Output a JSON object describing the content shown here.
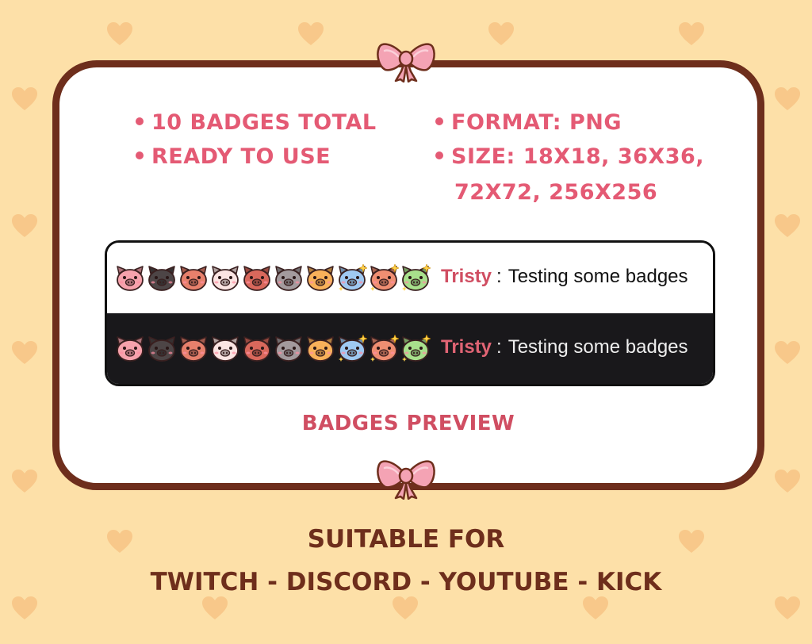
{
  "features": {
    "left": [
      "10 BADGES TOTAL",
      "READY TO USE"
    ],
    "right_line1": "FORMAT: PNG",
    "right_line2": "SIZE: 18X18, 36X36,",
    "right_line3": "72X72, 256X256"
  },
  "preview": {
    "username": "Tristy",
    "separator": ":",
    "message": "Testing some badges",
    "caption": "BADGES PREVIEW",
    "badges": [
      {
        "name": "pink-pig",
        "color": "#f6a2ac"
      },
      {
        "name": "black-pig",
        "color": "#4d4546"
      },
      {
        "name": "brown-pig",
        "color": "#e7806c"
      },
      {
        "name": "spotted-pig",
        "color": "#fbe4e2"
      },
      {
        "name": "red-brown-pig",
        "color": "#d9685c"
      },
      {
        "name": "gray-pig",
        "color": "#a39a9d"
      },
      {
        "name": "orange-pig",
        "color": "#f8b15a"
      },
      {
        "name": "blue-sparkle-pig",
        "color": "#9fc9f2"
      },
      {
        "name": "coral-sparkle-pig",
        "color": "#ef8e72"
      },
      {
        "name": "rainbow-sparkle-pig",
        "color": "#a8e08c"
      }
    ]
  },
  "footer": {
    "line1": "SUITABLE FOR",
    "line2": "TWITCH - DISCORD - YOUTUBE - KICK"
  },
  "colors": {
    "background": "#fde0a8",
    "heart": "#f8c88a",
    "frame": "#6e2e1c",
    "accent": "#e45a74",
    "bow": "#f4a3b4"
  }
}
